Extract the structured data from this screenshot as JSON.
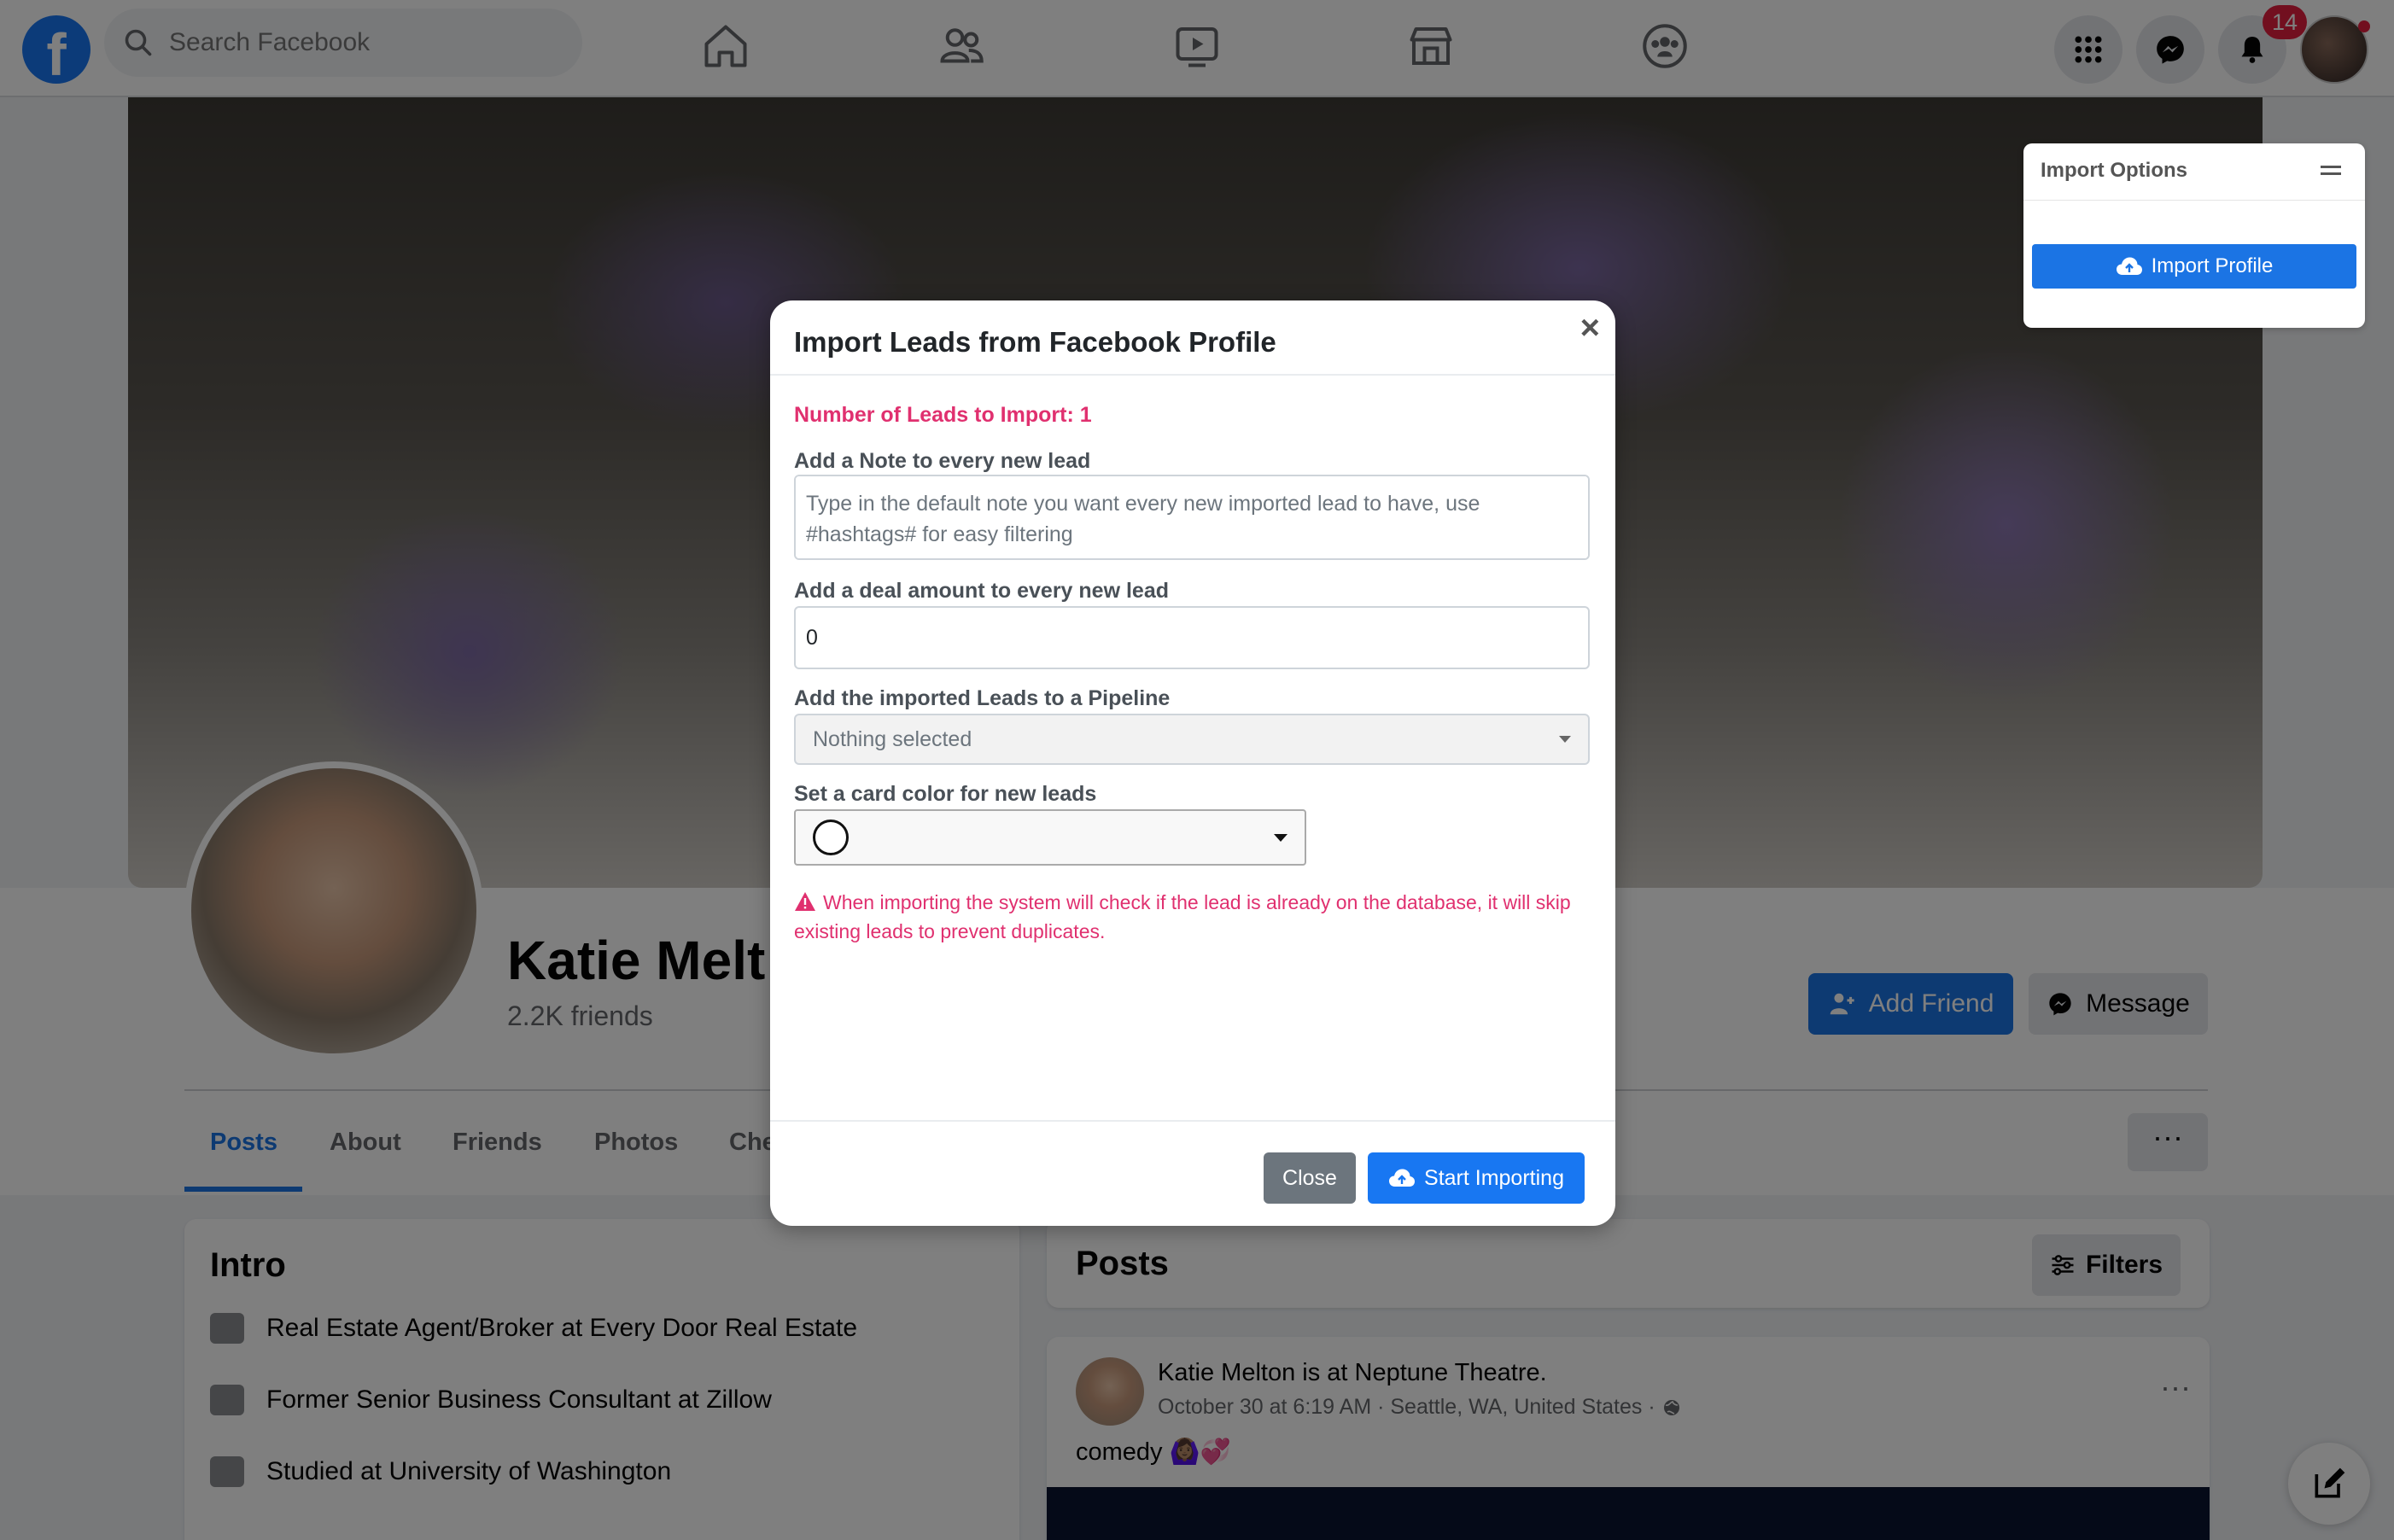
{
  "topbar": {
    "logo_letter": "f",
    "search_placeholder": "Search Facebook",
    "nav_icons": [
      "home-icon",
      "friends-icon",
      "watch-icon",
      "marketplace-icon",
      "groups-icon"
    ],
    "right_icons": [
      "menu-grid-icon",
      "messenger-icon",
      "bell-icon"
    ],
    "notifications_count": "14"
  },
  "profile": {
    "name": "Katie Melt",
    "friends": "2.2K friends",
    "add_friend_label": "Add Friend",
    "message_label": "Message",
    "tabs": [
      "Posts",
      "About",
      "Friends",
      "Photos",
      "Che"
    ],
    "active_tab": "Posts",
    "more_label": "···"
  },
  "intro": {
    "title": "Intro",
    "items": [
      "Real Estate Agent/Broker at Every Door Real Estate",
      "Former Senior Business Consultant at Zillow",
      "Studied at University of Washington"
    ]
  },
  "posts": {
    "title": "Posts",
    "filters_label": "Filters",
    "post": {
      "author_line": "Katie Melton is at Neptune Theatre.",
      "meta": "October 30 at 6:19 AM · Seattle, WA, United States ·",
      "text": "comedy 🙆🏽‍♀️💞",
      "more": "···"
    }
  },
  "import_options": {
    "title": "Import Options",
    "button_label": "Import Profile"
  },
  "modal": {
    "title": "Import Leads from Facebook  Profile",
    "close_x": "×",
    "leads_count": "Number of Leads to Import: 1",
    "note_label": "Add a Note to every new lead",
    "note_placeholder": "Type in the default note you want every new imported lead to have, use #hashtags# for easy filtering",
    "deal_label": "Add a deal amount to every new lead",
    "deal_value": "0",
    "pipeline_label": "Add the imported Leads to a Pipeline",
    "pipeline_value": "Nothing selected",
    "color_label": "Set a card color for new leads",
    "warning": "When importing the system will check if the lead is already on the database, it will skip existing leads to prevent duplicates.",
    "close_label": "Close",
    "start_label": "Start Importing"
  },
  "colors": {
    "facebook_blue": "#1877f2",
    "accent_pink": "#e0306f",
    "close_gray": "#6c757d",
    "badge_red": "#e41e3f"
  }
}
